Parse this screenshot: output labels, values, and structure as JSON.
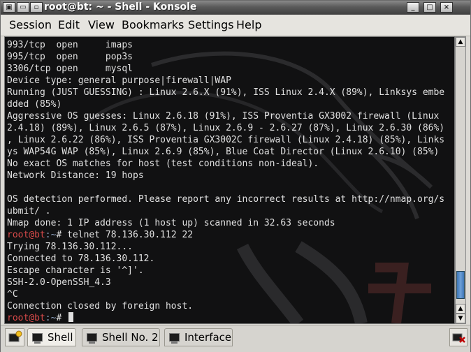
{
  "window": {
    "title": "root@bt: ~ - Shell - Konsole"
  },
  "menubar": {
    "items": [
      "Session",
      "Edit",
      "View",
      "Bookmarks",
      "Settings",
      "Help"
    ]
  },
  "terminal": {
    "lines": [
      {
        "text": "993/tcp  open     imaps"
      },
      {
        "text": "995/tcp  open     pop3s"
      },
      {
        "text": "3306/tcp open     mysql"
      },
      {
        "text": "Device type: general purpose|firewall|WAP"
      },
      {
        "text": "Running (JUST GUESSING) : Linux 2.6.X (91%), ISS Linux 2.4.X (89%), Linksys embe"
      },
      {
        "text": "dded (85%)"
      },
      {
        "text": "Aggressive OS guesses: Linux 2.6.18 (91%), ISS Proventia GX3002 firewall (Linux"
      },
      {
        "text": "2.4.18) (89%), Linux 2.6.5 (87%), Linux 2.6.9 - 2.6.27 (87%), Linux 2.6.30 (86%)"
      },
      {
        "text": ", Linux 2.6.22 (86%), ISS Proventia GX3002C firewall (Linux 2.4.18) (85%), Links"
      },
      {
        "text": "ys WAP54G WAP (85%), Linux 2.6.9 (85%), Blue Coat Director (Linux 2.6.10) (85%)"
      },
      {
        "text": "No exact OS matches for host (test conditions non-ideal)."
      },
      {
        "text": "Network Distance: 19 hops"
      },
      {
        "text": ""
      },
      {
        "text": "OS detection performed. Please report any incorrect results at http://nmap.org/s"
      },
      {
        "text": "ubmit/ ."
      },
      {
        "text": "Nmap done: 1 IP address (1 host up) scanned in 32.63 seconds"
      },
      {
        "prompt": "root@bt",
        "path": ":~",
        "text": "# telnet 78.136.30.112 22"
      },
      {
        "text": "Trying 78.136.30.112..."
      },
      {
        "text": "Connected to 78.136.30.112."
      },
      {
        "text": "Escape character is '^]'."
      },
      {
        "text": "SSH-2.0-OpenSSH_4.3"
      },
      {
        "text": "^C"
      },
      {
        "text": "Connection closed by foreign host."
      },
      {
        "prompt": "root@bt",
        "path": ":~",
        "text": "# "
      }
    ]
  },
  "tabs": [
    {
      "label": "Shell",
      "active": true
    },
    {
      "label": "Shell No. 2",
      "active": false
    },
    {
      "label": "Interface",
      "active": false
    }
  ],
  "colors": {
    "prompt": "#d94a4a",
    "terminal_bg": "#111112",
    "scroll_thumb": "#3b74b4"
  },
  "icons": {
    "window_menu": "konsole-icon",
    "new_tab": "new-tab-icon",
    "close_tab": "close-tab-icon"
  }
}
